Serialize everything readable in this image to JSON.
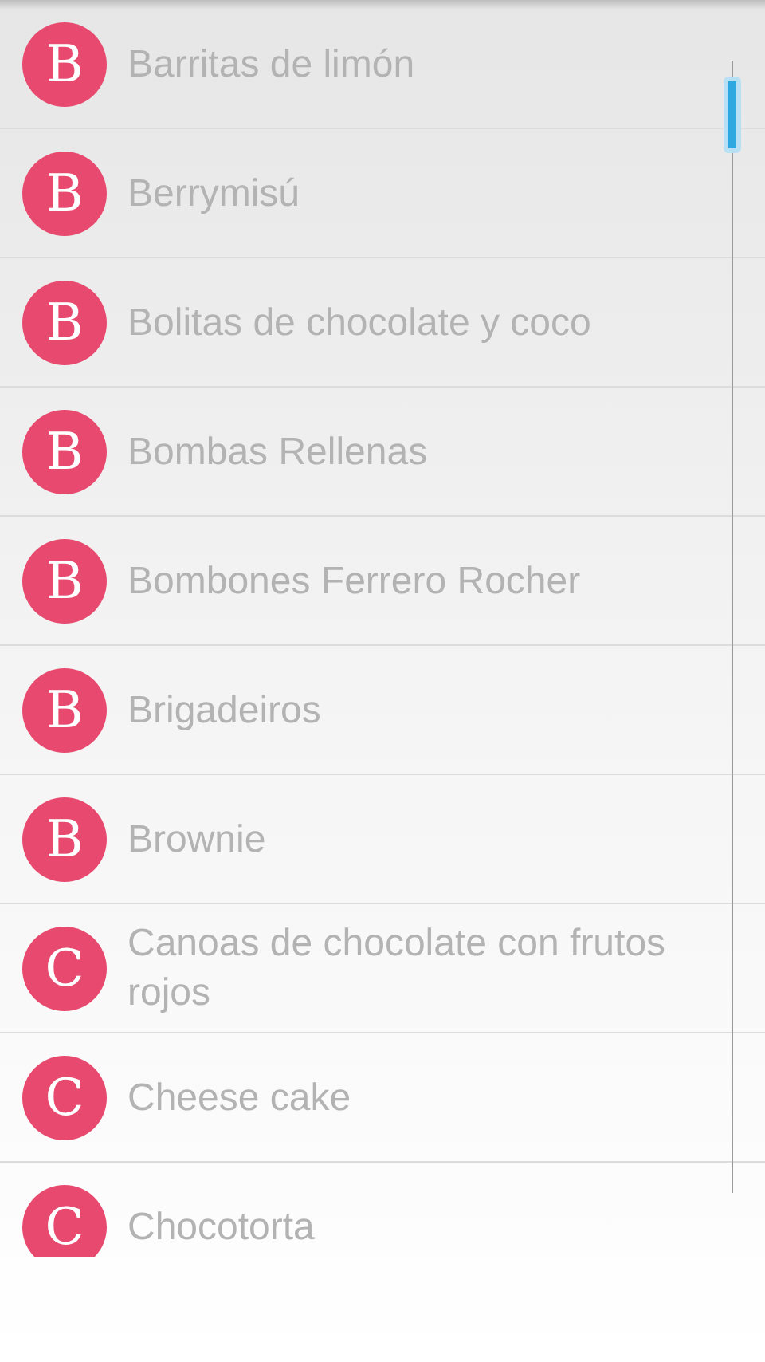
{
  "recipes": [
    {
      "initial": "B",
      "name": "Barritas de limón"
    },
    {
      "initial": "B",
      "name": "Berrymisú"
    },
    {
      "initial": "B",
      "name": "Bolitas de chocolate y coco"
    },
    {
      "initial": "B",
      "name": "Bombas Rellenas"
    },
    {
      "initial": "B",
      "name": "Bombones Ferrero Rocher"
    },
    {
      "initial": "B",
      "name": "Brigadeiros"
    },
    {
      "initial": "B",
      "name": "Brownie"
    },
    {
      "initial": "C",
      "name": "Canoas de chocolate con frutos rojos"
    },
    {
      "initial": "C",
      "name": "Cheese cake"
    },
    {
      "initial": "C",
      "name": "Chocotorta"
    }
  ]
}
